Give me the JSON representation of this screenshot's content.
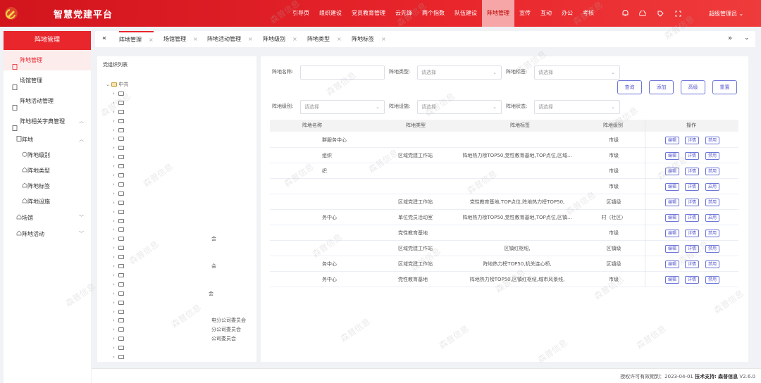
{
  "header": {
    "title": "智慧党建平台",
    "nav": [
      "引导页",
      "组织建设",
      "党员教育管理",
      "云先锋",
      "两个指数",
      "队伍建设",
      "阵地管理",
      "宣传",
      "互动",
      "办公",
      "考核"
    ],
    "active_nav": "阵地管理",
    "user": "超级管理员",
    "icons": [
      "bell-icon",
      "cloud-icon",
      "tag-icon",
      "fullscreen-icon"
    ],
    "brand_color": "#e8262c"
  },
  "sidebar": {
    "title": "阵地管理",
    "items": [
      {
        "label": "阵地管理",
        "active": true
      },
      {
        "label": "场馆管理"
      },
      {
        "label": "阵地活动管理"
      },
      {
        "label": "阵地相关字典管理",
        "expanded": true
      }
    ],
    "group": {
      "label": "阵地",
      "children": [
        "阵地级别",
        "阵地类型",
        "阵地标签",
        "阵地设施"
      ]
    },
    "extra": [
      {
        "label": "场馆"
      },
      {
        "label": "阵地活动"
      }
    ]
  },
  "tabs": [
    {
      "label": "阵地管理",
      "active": true
    },
    {
      "label": "场馆管理"
    },
    {
      "label": "阵地活动管理"
    },
    {
      "label": "阵地级别"
    },
    {
      "label": "阵地类型"
    },
    {
      "label": "阵地标签"
    }
  ],
  "tree": {
    "title": "党组织列表",
    "root": "中共",
    "fragments": [
      "会",
      "会",
      "会",
      "电分公司委员会",
      "分公司委员会",
      "公司委员会",
      "会"
    ]
  },
  "filters": {
    "name_label": "阵地名称:",
    "type_label": "阵地类型:",
    "tag_label": "阵地标签:",
    "level_label": "阵地级别:",
    "facility_label": "阵地设施:",
    "status_label": "阵地状态:",
    "placeholder": "请选择"
  },
  "buttons": {
    "query": "查询",
    "add": "添加",
    "advanced": "高级",
    "reset": "重置"
  },
  "table": {
    "columns": [
      "阵地名称",
      "阵地类型",
      "阵地标签",
      "阵地级别",
      "操作"
    ],
    "rows": [
      {
        "name": "群服务中心",
        "type": "",
        "tags": "",
        "level": "市级",
        "status_btn": "禁用"
      },
      {
        "name": "组织",
        "type": "区域党建工作站",
        "tags": "阵地热力榜TOP50,党性教育基地,TOP点位,区域...",
        "level": "市级",
        "status_btn": "禁用"
      },
      {
        "name": "织",
        "type": "",
        "tags": "",
        "level": "市级",
        "status_btn": "禁用"
      },
      {
        "name": "",
        "type": "",
        "tags": "",
        "level": "市级",
        "status_btn": "启用"
      },
      {
        "name": "",
        "type": "区域党建工作站",
        "tags": "党性教育基地,TOP点位,阵地热力榜TOP50,",
        "level": "区镇级",
        "status_btn": "禁用"
      },
      {
        "name": "务中心",
        "type": "单位党员活动室",
        "tags": "阵地热力榜TOP50,党性教育基地,TOP点位,区镇...",
        "level": "村（社区）",
        "status_btn": "启用"
      },
      {
        "name": "",
        "type": "党性教育基地",
        "tags": "",
        "level": "市级",
        "status_btn": "禁用"
      },
      {
        "name": "",
        "type": "区域党建工作站",
        "tags": "区镇红枢纽,",
        "level": "区镇级",
        "status_btn": "禁用"
      },
      {
        "name": "务中心",
        "type": "区域党建工作站",
        "tags": "阵地热力榜TOP50,机关连心桥,",
        "level": "区镇级",
        "status_btn": "禁用"
      },
      {
        "name": "务中心",
        "type": "党性教育基地",
        "tags": "阵地热力榜TOP50,区镇红枢纽,城市风景线,",
        "level": "市级",
        "status_btn": "禁用"
      }
    ],
    "edit_label": "编辑",
    "detail_label": "详情"
  },
  "footer": {
    "license": "授权许可有效期到：2023-04-01",
    "support_label": "技术支持:",
    "support": "森普信息",
    "version": "V2.6.0"
  },
  "watermark": "森普信息"
}
